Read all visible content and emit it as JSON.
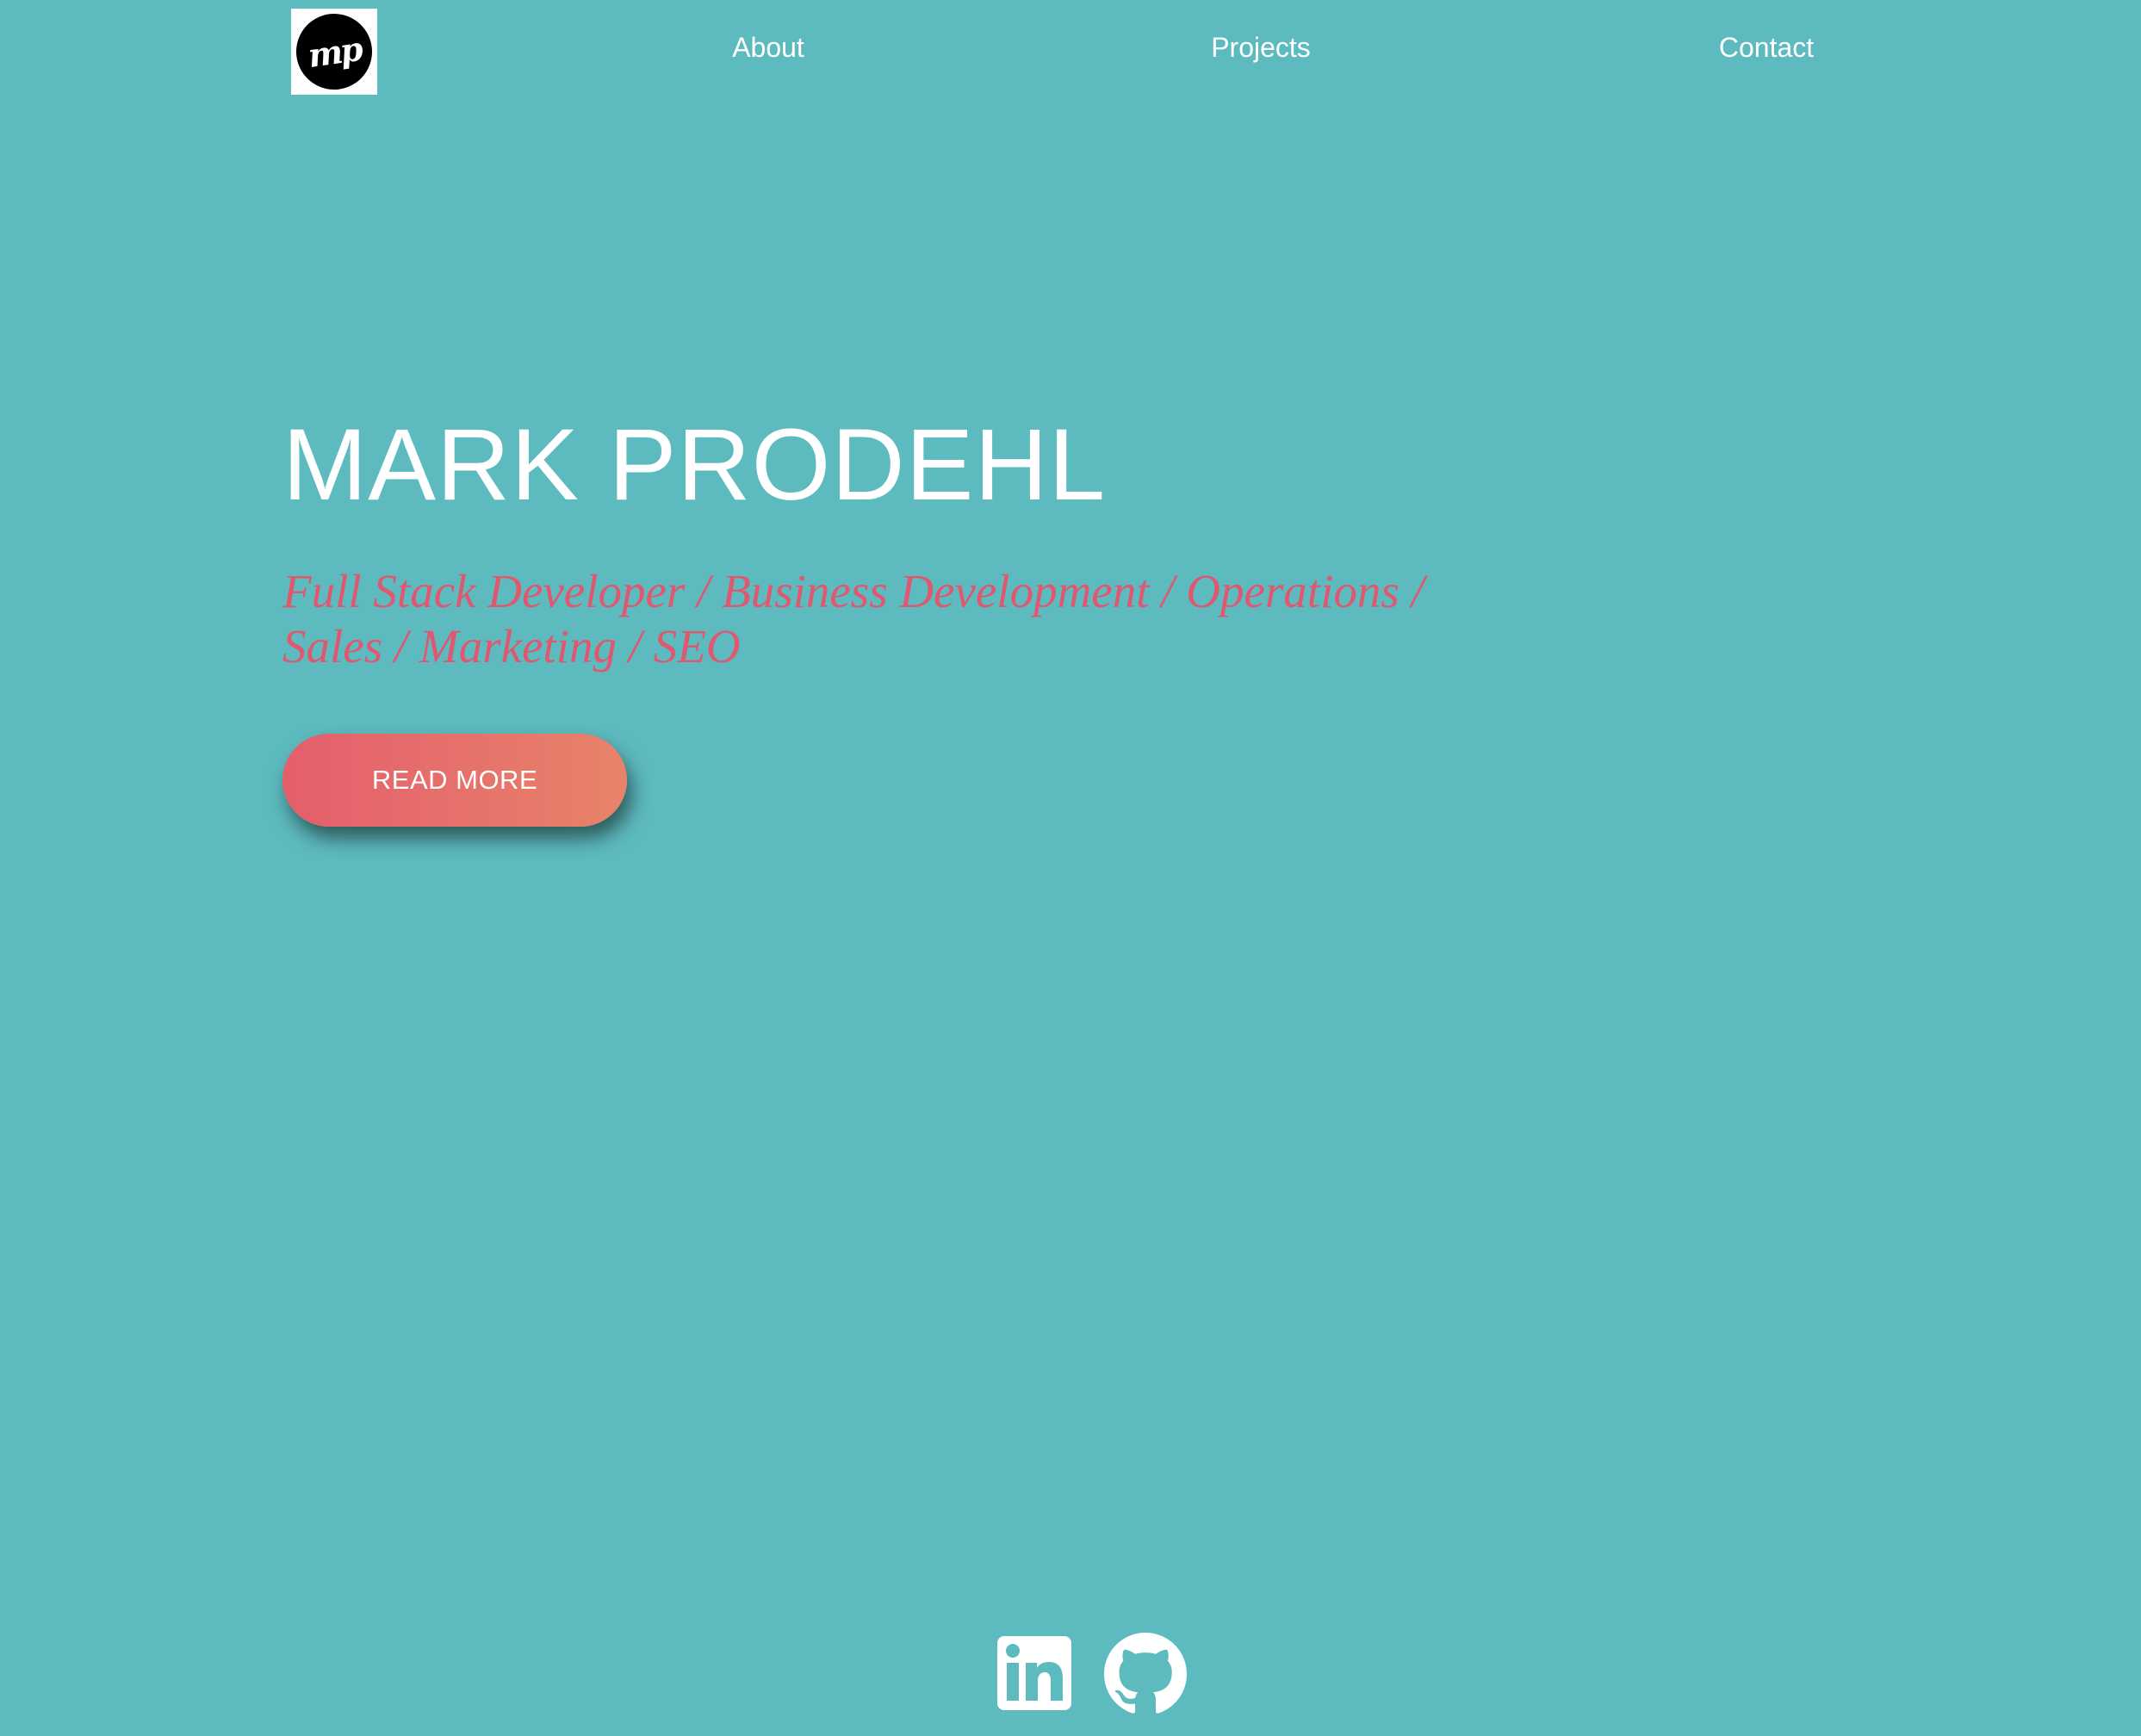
{
  "colors": {
    "background": "#5dbabe",
    "text": "#ffffff",
    "accent": "#e05870",
    "button_gradient_start": "#e45e6c",
    "button_gradient_end": "#e8836a",
    "logo_bg": "#ffffff",
    "logo_circle": "#000000"
  },
  "header": {
    "logo": {
      "text": "mp",
      "icon": "mp-monogram-logo"
    },
    "nav": {
      "about": "About",
      "projects": "Projects",
      "contact": "Contact"
    }
  },
  "hero": {
    "name": "MARK PRODEHL",
    "roles": "Full Stack Developer / Business Development / Operations / Sales / Marketing / SEO",
    "button_label": "READ MORE"
  },
  "footer": {
    "social": [
      {
        "icon": "linkedin-icon"
      },
      {
        "icon": "github-icon"
      }
    ]
  }
}
